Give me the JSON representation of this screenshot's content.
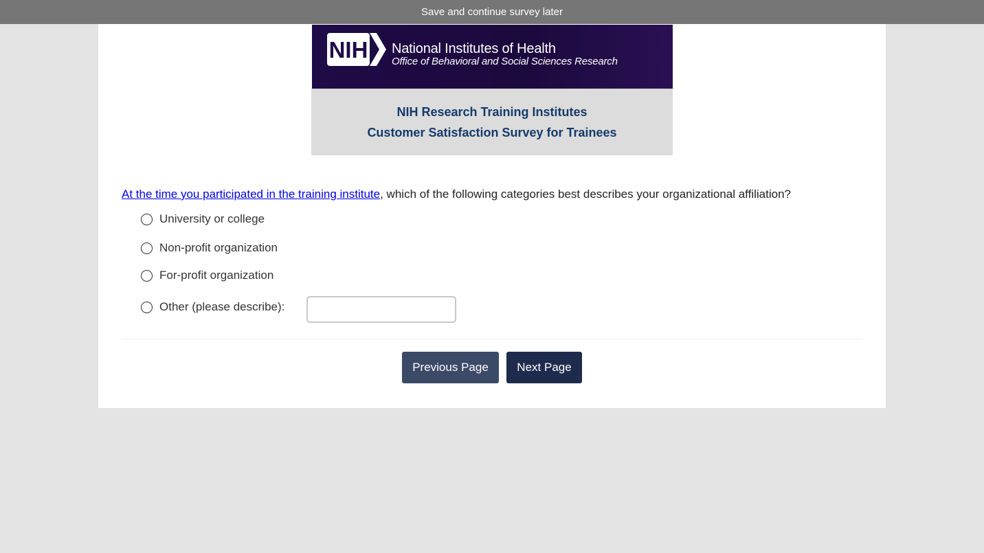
{
  "top_bar": {
    "save_link": "Save and continue survey later"
  },
  "header": {
    "logo_text": "NIH",
    "org_name": "National Institutes of Health",
    "office_name": "Office of Behavioral and Social Sciences Research",
    "survey_title_line1": "NIH Research Training Institutes",
    "survey_title_line2": "Customer Satisfaction Survey for Trainees"
  },
  "question": {
    "link_text": "At the time you participated in the training institute",
    "text": ", which of the following categories best describes your organizational affiliation?",
    "options": [
      {
        "label": "University or college",
        "selected": false
      },
      {
        "label": "Non-profit organization",
        "selected": false
      },
      {
        "label": "For-profit organization",
        "selected": false
      },
      {
        "label": "Other (please describe):",
        "selected": false
      }
    ],
    "other_input_value": ""
  },
  "navigation": {
    "previous_label": "Previous Page",
    "next_label": "Next Page"
  },
  "colors": {
    "page_background": "#e4e4e4",
    "top_bar": "#767676",
    "banner_dark": "#1f0b46",
    "banner_light": "#dcdcdc",
    "banner_title": "#143a6b",
    "button_previous": "#3b4a66",
    "button_next": "#1e2b4d",
    "link": "#0000ee"
  }
}
